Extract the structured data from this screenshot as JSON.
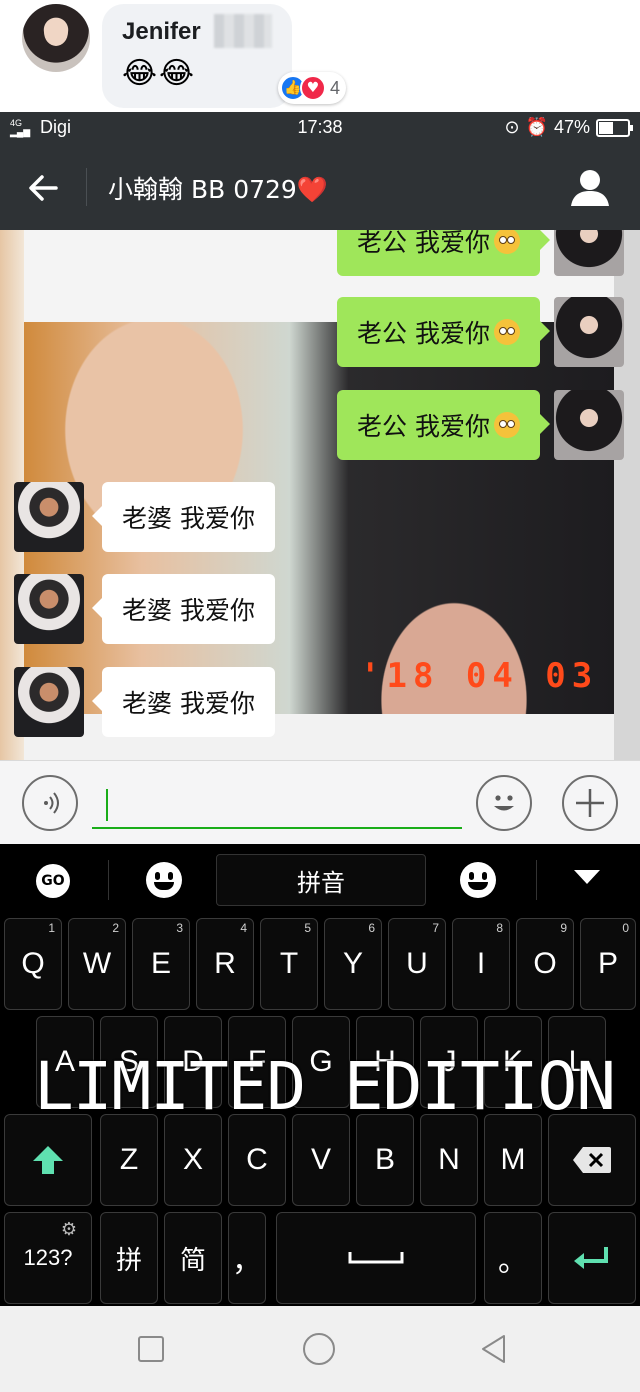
{
  "facebook_comment": {
    "name": "Jenifer",
    "emojis": "😂😂",
    "reaction_count": "4"
  },
  "status_bar": {
    "network": "4G",
    "carrier": "Digi",
    "time": "17:38",
    "battery": "47%"
  },
  "app_bar": {
    "title": "小翰翰 BB 0729❤️"
  },
  "messages_right": [
    {
      "text": "老公 我爱你"
    },
    {
      "text": "老公 我爱你"
    },
    {
      "text": "老公 我爱你"
    }
  ],
  "messages_left": [
    {
      "text": "老婆 我爱你"
    },
    {
      "text": "老婆 我爱你"
    },
    {
      "text": "老婆 我爱你"
    }
  ],
  "photo": {
    "date_stamp": "'18 04 03"
  },
  "input": {
    "value": ""
  },
  "keyboard": {
    "mode_label": "拼音",
    "go_label": "GO",
    "row1": [
      {
        "key": "Q",
        "hint": "1"
      },
      {
        "key": "W",
        "hint": "2"
      },
      {
        "key": "E",
        "hint": "3"
      },
      {
        "key": "R",
        "hint": "4"
      },
      {
        "key": "T",
        "hint": "5"
      },
      {
        "key": "Y",
        "hint": "6"
      },
      {
        "key": "U",
        "hint": "7"
      },
      {
        "key": "I",
        "hint": "8"
      },
      {
        "key": "O",
        "hint": "9"
      },
      {
        "key": "P",
        "hint": "0"
      }
    ],
    "row2": [
      "A",
      "S",
      "D",
      "F",
      "G",
      "H",
      "J",
      "K",
      "L"
    ],
    "row3": [
      "Z",
      "X",
      "C",
      "V",
      "B",
      "N",
      "M"
    ],
    "num_label": "123?",
    "pin_label": "拼",
    "jian_label": "简",
    "comma_label": "，",
    "period_label": "。"
  },
  "watermark": "LIMITED EDITION",
  "colors": {
    "wechat_green": "#9fe65a",
    "dark_bar": "#2e3235",
    "enter_accent": "#5fe0b0"
  }
}
